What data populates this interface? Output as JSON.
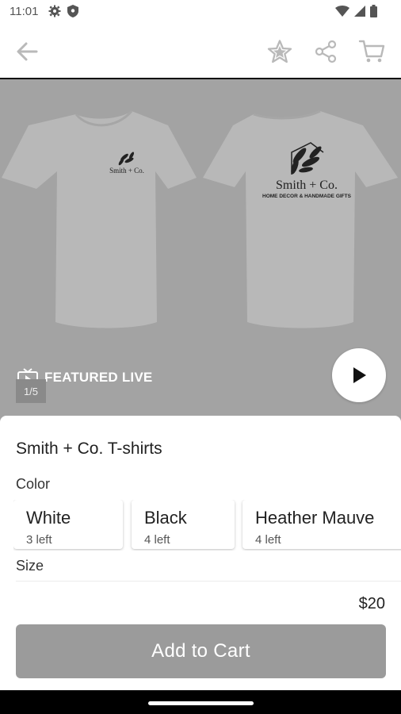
{
  "status_bar": {
    "time": "11:01",
    "icons": [
      "gear-icon",
      "shield-icon",
      "wifi-icon",
      "signal-icon",
      "battery-icon"
    ]
  },
  "app_bar": {
    "icons": [
      "back-arrow-icon",
      "star-icon",
      "share-icon",
      "cart-icon"
    ]
  },
  "hero": {
    "featured_label": "FEATURED LIVE",
    "counter": "1/5",
    "front_brand": "Smith + Co.",
    "back_brand": "Smith + Co.",
    "back_tagline": "HOME DECOR & HANDMADE GIFTS"
  },
  "product": {
    "title": "Smith + Co. T-shirts",
    "color_label": "Color",
    "variants": [
      {
        "name": "White",
        "stock": "3 left"
      },
      {
        "name": "Black",
        "stock": "4 left"
      },
      {
        "name": "Heather Mauve",
        "stock": "4 left"
      }
    ],
    "size_label": "Size",
    "price": "$20",
    "add_to_cart_label": "Add to Cart"
  },
  "colors": {
    "hero_bg": "#a3a3a3",
    "button_disabled": "#9b9b9b"
  }
}
